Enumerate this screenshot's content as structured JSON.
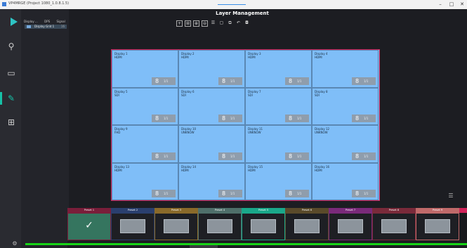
{
  "window": {
    "title": "VP4MRGE (Project 1080_1.0.8.1.5)",
    "minimize": "–",
    "maximize": "□",
    "close": "✕"
  },
  "left_rail": {
    "icons": [
      "search-icon",
      "monitor-icon",
      "edit-icon",
      "grid-icon"
    ]
  },
  "tree": {
    "tabs": [
      "Display ...",
      "DPS",
      "Signal"
    ],
    "item_label": "Display Grid 1",
    "item_count": "16"
  },
  "header": {
    "title": "Layer Management",
    "tools": [
      "+",
      "⊞",
      "⊕",
      "⊖",
      "☰",
      "▢",
      "⧉",
      "↶",
      "◘"
    ]
  },
  "displays": [
    {
      "name": "Display 1",
      "source": "HDMI",
      "num": "8",
      "sub": "1/1"
    },
    {
      "name": "Display 2",
      "source": "HDMI",
      "num": "8",
      "sub": "1/1"
    },
    {
      "name": "Display 3",
      "source": "HDMI",
      "num": "8",
      "sub": "1/1"
    },
    {
      "name": "Display 4",
      "source": "HDMI",
      "num": "8",
      "sub": "1/1"
    },
    {
      "name": "Display 5",
      "source": "SDI",
      "num": "8",
      "sub": "1/1"
    },
    {
      "name": "Display 6",
      "source": "SDI",
      "num": "8",
      "sub": "1/1"
    },
    {
      "name": "Display 7",
      "source": "SDI",
      "num": "8",
      "sub": "1/1"
    },
    {
      "name": "Display 8",
      "source": "SDI",
      "num": "8",
      "sub": "1/1"
    },
    {
      "name": "Display 9",
      "source": "FHD",
      "num": "8",
      "sub": "1/1"
    },
    {
      "name": "Display 10",
      "source": "UNKNOW",
      "num": "8",
      "sub": "1/1"
    },
    {
      "name": "Display 11",
      "source": "UNKNOW",
      "num": "8",
      "sub": "1/1"
    },
    {
      "name": "Display 12",
      "source": "UNKNOW",
      "num": "8",
      "sub": "1/1"
    },
    {
      "name": "Display 13",
      "source": "HDMI",
      "num": "8",
      "sub": "1/1"
    },
    {
      "name": "Display 14",
      "source": "HDMI",
      "num": "8",
      "sub": "1/1"
    },
    {
      "name": "Display 15",
      "source": "HDMI",
      "num": "8",
      "sub": "1/1"
    },
    {
      "name": "Display 16",
      "source": "HDMI",
      "num": "8",
      "sub": "1/1"
    }
  ],
  "presets": [
    {
      "label": "Preset 1",
      "color": "#7a1e3a",
      "active": true
    },
    {
      "label": "Preset 2",
      "color": "#2a3f6e",
      "active": false
    },
    {
      "label": "Preset 3",
      "color": "#8a6a2a",
      "active": false
    },
    {
      "label": "Preset 4",
      "color": "#4f6f6a",
      "active": false
    },
    {
      "label": "Preset 5",
      "color": "#1aa88a",
      "active": false
    },
    {
      "label": "Preset 6",
      "color": "#5a4a2a",
      "active": false
    },
    {
      "label": "Preset 7",
      "color": "#7a2a7a",
      "active": false
    },
    {
      "label": "Preset 8",
      "color": "#7a2a3a",
      "active": false
    },
    {
      "label": "Preset 9",
      "color": "#c06a6a",
      "active": false
    }
  ],
  "colors": {
    "canvas_border": "#d0235a",
    "cell_fill": "#7fbef8",
    "accent": "#16c0a6",
    "progress": "#18d418"
  }
}
